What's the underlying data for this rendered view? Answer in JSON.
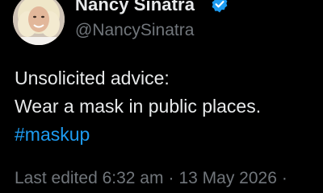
{
  "colors": {
    "background": "#000000",
    "text_primary": "#e7e9ea",
    "text_secondary": "#71767b",
    "link": "#1d9bf0",
    "verified_badge": "#1d9bf0"
  },
  "author": {
    "name": "Nancy Sinatra",
    "handle": "@NancySinatra",
    "verified_icon": "verified-badge-icon",
    "avatar_icon": "profile-photo"
  },
  "post": {
    "line1": "Unsolicited advice:",
    "line2": "Wear a mask in public places.",
    "hashtag": "#maskup"
  },
  "meta": {
    "edited_label": "Last edited",
    "time": "6:32 am",
    "separator": "·",
    "date": "13 May 2026",
    "trailing_separator": "·"
  }
}
